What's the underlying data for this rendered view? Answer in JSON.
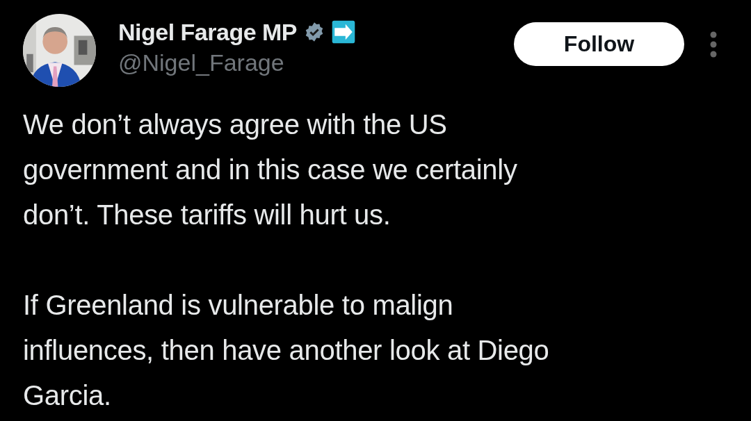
{
  "author": {
    "name": "Nigel Farage MP",
    "handle": "@Nigel_Farage",
    "verified": true
  },
  "follow_button": {
    "label": "Follow"
  },
  "paragraphs": [
    "We don’t always agree with the US\ngovernment and in this case we certainly\ndon’t. These tariffs will hurt us.",
    "If Greenland is vulnerable to malign\ninfluences, then have another look at Diego\nGarcia."
  ]
}
